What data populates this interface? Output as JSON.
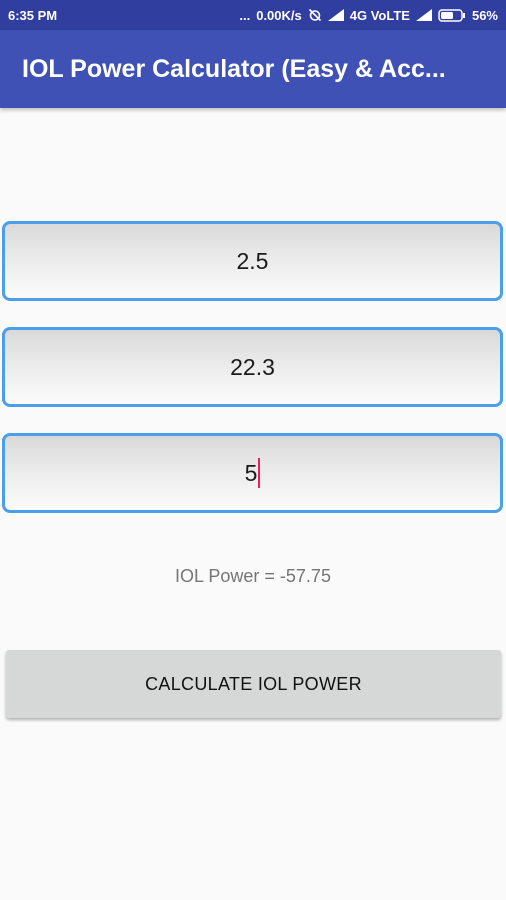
{
  "status_bar": {
    "time": "6:35 PM",
    "dots": "...",
    "net_speed": "0.00K/s",
    "network": "4G VoLTE",
    "battery": "56%",
    "icons": [
      "alarm-off-icon",
      "signal-icon",
      "signal-icon",
      "battery-icon"
    ]
  },
  "app_bar": {
    "title": "IOL Power Calculator (Easy & Acc..."
  },
  "fields": [
    {
      "value": "2.5"
    },
    {
      "value": "22.3"
    },
    {
      "value": "5"
    }
  ],
  "result": {
    "text": "IOL Power = -57.75"
  },
  "button": {
    "label": "CALCULATE IOL POWER"
  },
  "colors": {
    "status_bar": "#303f9f",
    "app_bar": "#3f51b5",
    "field_border": "#4a9eea",
    "cursor": "#e91e63",
    "button_bg": "#d6d7d7"
  }
}
